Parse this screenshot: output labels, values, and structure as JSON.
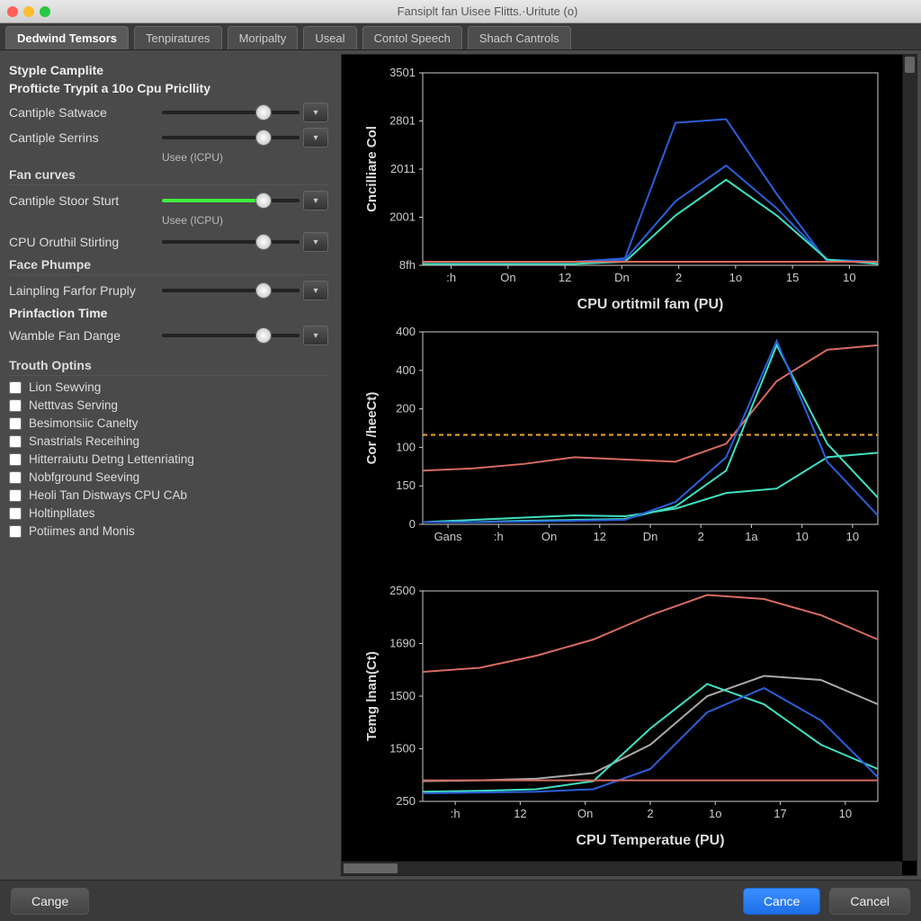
{
  "window_title": "Fansiplt fan Uisee Flitts.·Uritute (o)",
  "tabs": [
    {
      "label": "Dedwind Temsors",
      "active": true
    },
    {
      "label": "Tenpiratures"
    },
    {
      "label": "Moripalty"
    },
    {
      "label": "Useal"
    },
    {
      "label": "Contol Speech"
    },
    {
      "label": "Shach Cantrols"
    }
  ],
  "left_panel": {
    "head1": "Styple Camplite",
    "head2": "Profticte Trypit a 10o Cpu Pricllity",
    "sliders_a": [
      {
        "label": "Cantiple Satwace"
      },
      {
        "label": "Cantiple Serrins",
        "hint": "Usee (ICPU)"
      }
    ],
    "group_fan": "Fan curves",
    "sliders_b": [
      {
        "label": "Cantiple Stoor Sturt",
        "green": true,
        "hint": "Usee (ICPU)"
      },
      {
        "label": "CPU Oruthil Stirting"
      }
    ],
    "group_face": "Face Phumpe",
    "sliders_c": [
      {
        "label": "Lainpling Farfor Pruply"
      }
    ],
    "group_prin": "Prinfaction Time",
    "sliders_d": [
      {
        "label": "Wamble Fan Dange"
      }
    ],
    "group_opts": "Trouth Optins",
    "checks": [
      "Lion Sewving",
      "Netttvas Serving",
      "Besimonsiic Canelty",
      "Snastrials Receihing",
      "Hitterraiutu Detng Lettenriating",
      "Nobfground Seeving",
      "Heoli Tan Distways CPU CAb",
      "Holtinpllates",
      "Potiimes and Monis"
    ]
  },
  "footer": {
    "left": "Cange",
    "primary": "Cance",
    "secondary": "Cancel"
  },
  "chart_data": [
    {
      "type": "line",
      "title": "",
      "xlabel": "CPU ortitmil fam (PU)",
      "ylabel": "Cncilliare Col",
      "x_ticks": [
        ":h",
        "On",
        "12",
        "Dn",
        "2",
        "1o",
        "15",
        "10"
      ],
      "y_ticks": [
        "8fh",
        "2001",
        "2011",
        "2801",
        "3501"
      ],
      "ylim": [
        80,
        350
      ],
      "series": [
        {
          "name": "blue-outer",
          "color": "#2b5fd9",
          "values": [
            85,
            85,
            85,
            85,
            90,
            280,
            285,
            180,
            85,
            85
          ]
        },
        {
          "name": "blue-inner",
          "color": "#2b5fd9",
          "values": [
            85,
            85,
            85,
            85,
            88,
            170,
            220,
            160,
            88,
            85
          ]
        },
        {
          "name": "teal",
          "color": "#3fe0c0",
          "values": [
            82,
            82,
            82,
            82,
            85,
            150,
            200,
            150,
            88,
            82
          ]
        },
        {
          "name": "red",
          "color": "#d86b60",
          "values": [
            85,
            85,
            85,
            85,
            85,
            85,
            85,
            85,
            85,
            85
          ]
        }
      ]
    },
    {
      "type": "line",
      "xlabel": "",
      "ylabel": "Cor /heeCt)",
      "x_ticks": [
        "Gans",
        ":h",
        "On",
        "12",
        "Dn",
        "2",
        "1a",
        "10",
        "10"
      ],
      "y_ticks": [
        "0",
        "150",
        "100",
        "200",
        "400",
        "400"
      ],
      "ylim": [
        0,
        430
      ],
      "threshold": {
        "y": 200,
        "color": "#f5a623",
        "dash": true
      },
      "series": [
        {
          "name": "red",
          "color": "#d86b60",
          "values": [
            120,
            125,
            135,
            150,
            145,
            140,
            180,
            320,
            390,
            400
          ]
        },
        {
          "name": "teal-low",
          "color": "#3fe0c0",
          "values": [
            5,
            10,
            15,
            20,
            18,
            35,
            70,
            80,
            150,
            160
          ]
        },
        {
          "name": "teal-high",
          "color": "#3fe0c0",
          "values": [
            5,
            5,
            8,
            10,
            12,
            40,
            120,
            400,
            180,
            60
          ]
        },
        {
          "name": "blue",
          "color": "#2b5fd9",
          "values": [
            5,
            5,
            6,
            8,
            10,
            50,
            150,
            410,
            140,
            20
          ]
        }
      ]
    },
    {
      "type": "line",
      "xlabel": "CPU Temperatue (PU)",
      "ylabel": "Temg lnan(Ct)",
      "x_ticks": [
        ":h",
        "12",
        "On",
        "2",
        "1o",
        "17",
        "10"
      ],
      "y_ticks": [
        "250",
        "1500",
        "1500",
        "1690",
        "2500"
      ],
      "ylim": [
        0,
        2600
      ],
      "series": [
        {
          "name": "red",
          "color": "#d86b60",
          "values": [
            1600,
            1650,
            1800,
            2000,
            2300,
            2550,
            2500,
            2300,
            2000
          ]
        },
        {
          "name": "grey",
          "color": "#aaaaaa",
          "values": [
            250,
            260,
            280,
            350,
            700,
            1300,
            1550,
            1500,
            1200
          ]
        },
        {
          "name": "teal",
          "color": "#3fe0c0",
          "values": [
            120,
            130,
            150,
            250,
            900,
            1450,
            1200,
            700,
            400
          ]
        },
        {
          "name": "blue",
          "color": "#2b5fd9",
          "values": [
            100,
            110,
            120,
            150,
            400,
            1100,
            1400,
            1000,
            300
          ]
        },
        {
          "name": "red-flat",
          "color": "#d86b60",
          "values": [
            260,
            260,
            260,
            260,
            260,
            260,
            260,
            260,
            260
          ]
        }
      ]
    }
  ]
}
